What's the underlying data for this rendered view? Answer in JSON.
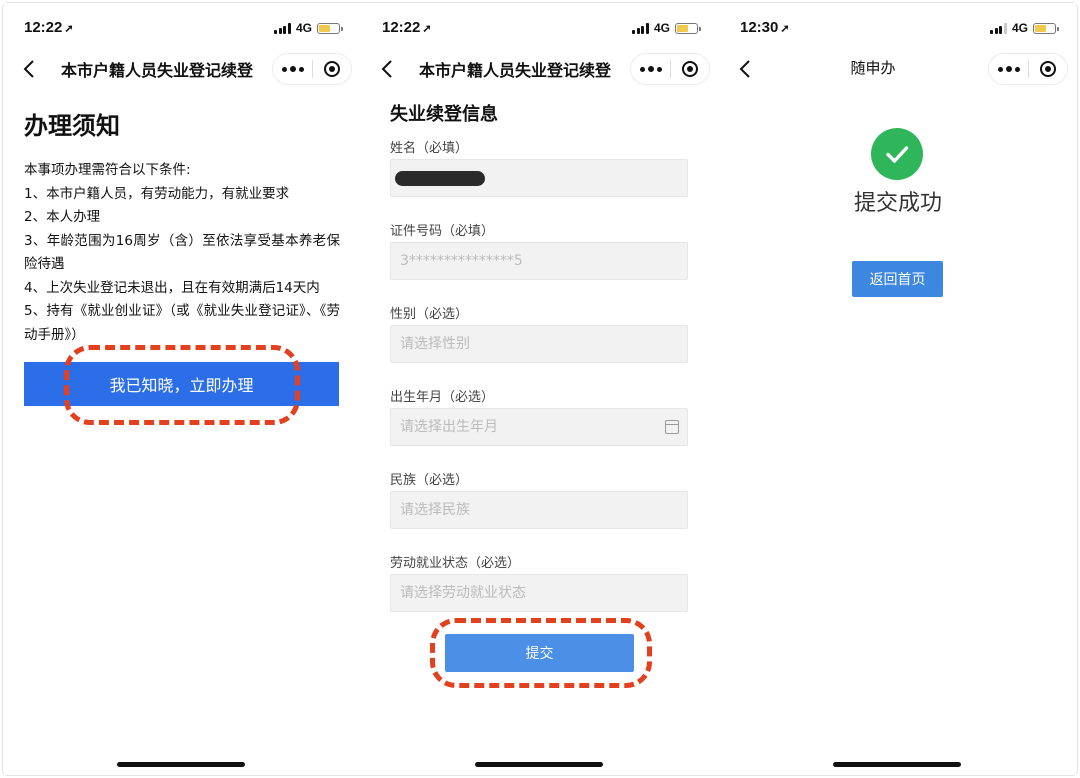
{
  "screens": [
    {
      "status": {
        "time": "12:22",
        "network": "4G"
      },
      "nav_title": "本市户籍人员失业登记续登",
      "page_title": "办理须知",
      "notice_lines": [
        "本事项办理需符合以下条件:",
        "1、本市户籍人员，有劳动能力，有就业要求",
        "2、本人办理",
        "3、年龄范围为16周岁（含）至依法享受基本养老保险待遇",
        "4、上次失业登记未退出，且在有效期满后14天内",
        "5、持有《就业创业证》（或《就业失业登记证》、《劳动手册》）"
      ],
      "primary_button": "我已知晓，立即办理"
    },
    {
      "status": {
        "time": "12:22",
        "network": "4G"
      },
      "nav_title": "本市户籍人员失业登记续登",
      "form_title": "失业续登信息",
      "fields": [
        {
          "label": "姓名（必填）",
          "value": "",
          "placeholder": ""
        },
        {
          "label": "证件号码（必填）",
          "value": "3***************5",
          "placeholder": ""
        },
        {
          "label": "性别（必选）",
          "value": "",
          "placeholder": "请选择性别"
        },
        {
          "label": "出生年月（必选）",
          "value": "",
          "placeholder": "请选择出生年月"
        },
        {
          "label": "民族（必选）",
          "value": "",
          "placeholder": "请选择民族"
        },
        {
          "label": "劳动就业状态（必选）",
          "value": "",
          "placeholder": "请选择劳动就业状态"
        }
      ],
      "submit_button": "提交"
    },
    {
      "status": {
        "time": "12:30",
        "network": "4G"
      },
      "nav_title": "随申办",
      "success_text": "提交成功",
      "home_button": "返回首页"
    }
  ],
  "colors": {
    "primary_blue": "#2c6ee8",
    "submit_blue": "#4b8fe6",
    "success_green": "#2fb55a",
    "annotation_red": "#e2401f",
    "battery_yellow": "#f2c94c"
  }
}
